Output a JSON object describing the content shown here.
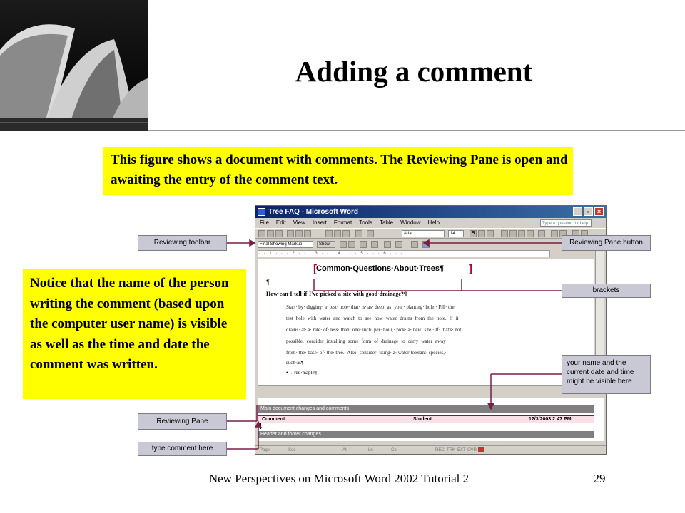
{
  "slide": {
    "title": "Adding a comment",
    "top_callout": "This figure shows a document with comments. The Reviewing Pane is open and awaiting the entry of the comment text.",
    "side_callout": "Notice that the name of the person writing the comment (based upon the computer user name) is visible as well as the time and date the comment was written.",
    "footer": "New Perspectives on Microsoft Word 2002 Tutorial 2",
    "page_number": "29"
  },
  "labels": {
    "reviewing_toolbar": "Reviewing toolbar",
    "reviewing_pane_button": "Reviewing Pane button",
    "brackets": "brackets",
    "name_date": "your name and the current date and time might be visible here",
    "reviewing_pane": "Reviewing Pane",
    "type_comment": "type comment here"
  },
  "word": {
    "window_title": "Tree FAQ - Microsoft Word",
    "menu": [
      "File",
      "Edit",
      "View",
      "Insert",
      "Format",
      "Tools",
      "Table",
      "Window",
      "Help"
    ],
    "help_placeholder": "Type a question for help",
    "markup_dropdown": "Final Showing Markup",
    "show_button": "Show",
    "font": "Arial",
    "font_size": "14",
    "doc": {
      "heading": "Common·Questions·About·Trees¶",
      "pilcrow": "¶",
      "question": "How·can·I·tell·if·I've·picked·a·site·with·good·drainage?¶",
      "body_lines": [
        "Start· by· digging· a· test· hole· that· is· as· deep· as· your· planting· hole.· Fill· the·",
        "test· hole· with· water· and· watch· to· see· how· water· drains· from· the· hole.· If· it·",
        "drains· at· a· rate· of· less· than· one· inch· per· hour,· pick· a· new· site.· If· that's· not·",
        "possible,· consider· installing· some· form· of· drainage· to· carry· water· away·",
        "from· the· base· of· the· tree.· Also· consider· using· a· water-tolerant· species,·",
        "such·as¶"
      ],
      "bullet": "•→ red·maple¶"
    },
    "pane": {
      "main_changes": "Main document changes and comments",
      "comment_label": "Comment",
      "author": "Student",
      "datetime": "12/3/2003 2:47 PM",
      "header_changes": "Header and footer changes"
    },
    "status": [
      "Page",
      "Sec",
      "At",
      "Ln",
      "Col",
      "REC",
      "TRK",
      "EXT",
      "OVR"
    ]
  },
  "colors": {
    "callout": "#ffff00",
    "label_bg": "#c9c9d6",
    "bracket": "#b0003a"
  }
}
